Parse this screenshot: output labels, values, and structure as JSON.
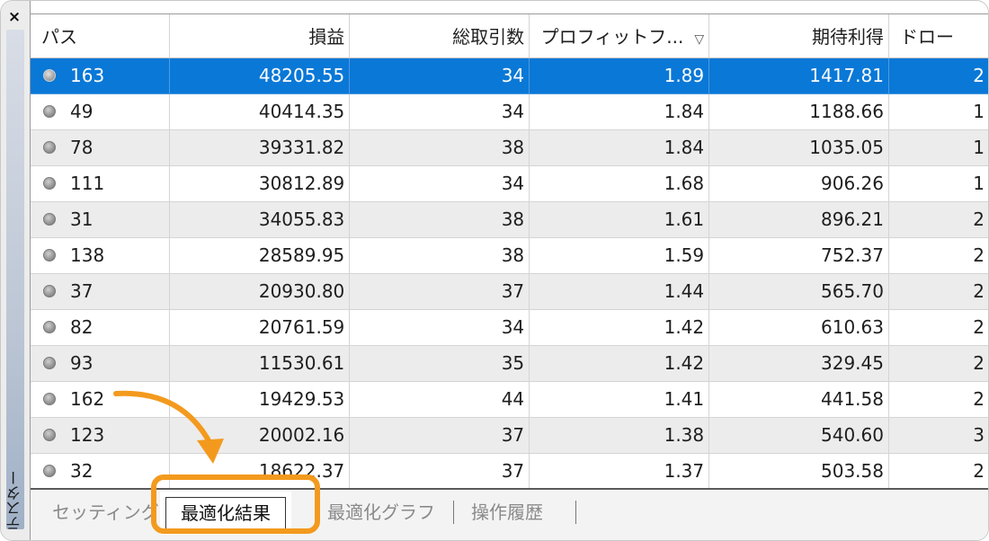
{
  "sidebar": {
    "close_label": "×",
    "panel_label": "テスター"
  },
  "table": {
    "columns": [
      "パス",
      "損益",
      "総取引数",
      "プロフィットフ...",
      "期待利得",
      "ドロー"
    ],
    "sort_indicator": "▽",
    "rows": [
      {
        "pass": "163",
        "profit": "48205.55",
        "trades": "34",
        "pf": "1.89",
        "expected": "1417.81",
        "dd": "2"
      },
      {
        "pass": "49",
        "profit": "40414.35",
        "trades": "34",
        "pf": "1.84",
        "expected": "1188.66",
        "dd": "1"
      },
      {
        "pass": "78",
        "profit": "39331.82",
        "trades": "38",
        "pf": "1.84",
        "expected": "1035.05",
        "dd": "1"
      },
      {
        "pass": "111",
        "profit": "30812.89",
        "trades": "34",
        "pf": "1.68",
        "expected": "906.26",
        "dd": "1"
      },
      {
        "pass": "31",
        "profit": "34055.83",
        "trades": "38",
        "pf": "1.61",
        "expected": "896.21",
        "dd": "2"
      },
      {
        "pass": "138",
        "profit": "28589.95",
        "trades": "38",
        "pf": "1.59",
        "expected": "752.37",
        "dd": "2"
      },
      {
        "pass": "37",
        "profit": "20930.80",
        "trades": "37",
        "pf": "1.44",
        "expected": "565.70",
        "dd": "2"
      },
      {
        "pass": "82",
        "profit": "20761.59",
        "trades": "34",
        "pf": "1.42",
        "expected": "610.63",
        "dd": "2"
      },
      {
        "pass": "93",
        "profit": "11530.61",
        "trades": "35",
        "pf": "1.42",
        "expected": "329.45",
        "dd": "2"
      },
      {
        "pass": "162",
        "profit": "19429.53",
        "trades": "44",
        "pf": "1.41",
        "expected": "441.58",
        "dd": "2"
      },
      {
        "pass": "123",
        "profit": "20002.16",
        "trades": "37",
        "pf": "1.38",
        "expected": "540.60",
        "dd": "3"
      },
      {
        "pass": "32",
        "profit": "18622.37",
        "trades": "37",
        "pf": "1.37",
        "expected": "503.58",
        "dd": "2"
      }
    ],
    "selected_row": 0
  },
  "tabs": {
    "settings": "セッティング",
    "results": "最適化結果",
    "graph": "最適化グラフ",
    "ops_log": "操作履歴"
  },
  "colors": {
    "selection": "#0a78d7",
    "highlight": "#f39a1e"
  }
}
